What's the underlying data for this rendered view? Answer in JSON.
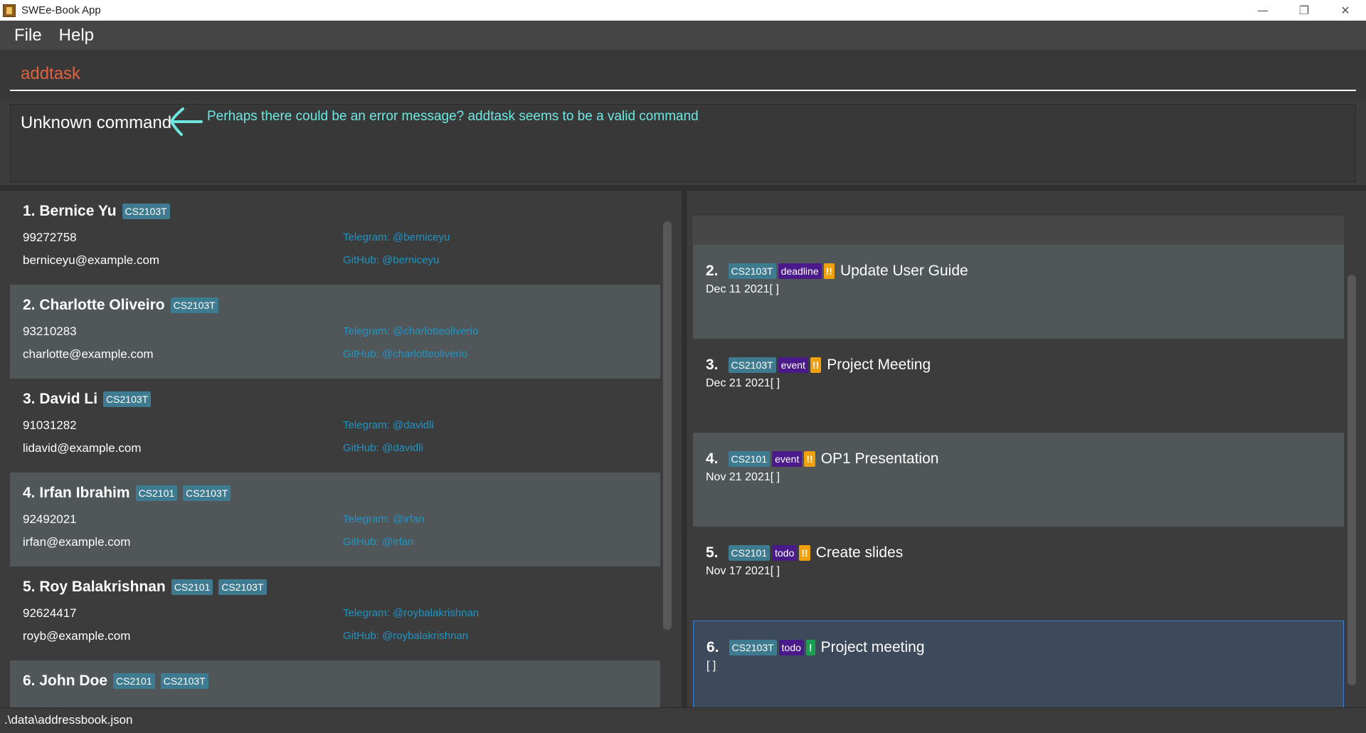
{
  "window": {
    "title": "SWEe-Book App",
    "minimize": "—",
    "restore": "❐",
    "close": "✕"
  },
  "menu": [
    "File",
    "Help"
  ],
  "command": {
    "value": "addtask"
  },
  "result": {
    "text": "Unknown command",
    "annotation": "Perhaps there could be an error message? addtask seems to be a valid command"
  },
  "persons": [
    {
      "index": "1.",
      "name": "Bernice Yu",
      "tags": [
        "CS2103T"
      ],
      "phone": "99272758",
      "email": "berniceyu@example.com",
      "telegram": "Telegram: @berniceyu",
      "github": "GitHub: @berniceyu"
    },
    {
      "index": "2.",
      "name": "Charlotte Oliveiro",
      "tags": [
        "CS2103T"
      ],
      "phone": "93210283",
      "email": "charlotte@example.com",
      "telegram": "Telegram: @charlotteoliverio",
      "github": "GitHub: @charlotteoliverio"
    },
    {
      "index": "3.",
      "name": "David Li",
      "tags": [
        "CS2103T"
      ],
      "phone": "91031282",
      "email": "lidavid@example.com",
      "telegram": "Telegram: @davidli",
      "github": "GitHub: @davidli"
    },
    {
      "index": "4.",
      "name": "Irfan Ibrahim",
      "tags": [
        "CS2101",
        "CS2103T"
      ],
      "phone": "92492021",
      "email": "irfan@example.com",
      "telegram": "Telegram: @irfan",
      "github": "GitHub: @irfan"
    },
    {
      "index": "5.",
      "name": "Roy Balakrishnan",
      "tags": [
        "CS2101",
        "CS2103T"
      ],
      "phone": "92624417",
      "email": "royb@example.com",
      "telegram": "Telegram: @roybalakrishnan",
      "github": "GitHub: @roybalakrishnan"
    },
    {
      "index": "6.",
      "name": "John Doe",
      "tags": [
        "CS2101",
        "CS2103T"
      ],
      "phone": "",
      "email": "",
      "telegram": "",
      "github": ""
    }
  ],
  "tasks": [
    {
      "index": "2.",
      "module": "CS2103T",
      "type": "deadline",
      "priority": "!!",
      "priority_level": "high",
      "name": "Update User Guide",
      "date": "Dec 11 2021[ ]"
    },
    {
      "index": "3.",
      "module": "CS2103T",
      "type": "event",
      "priority": "!!",
      "priority_level": "high",
      "name": "Project Meeting",
      "date": "Dec 21 2021[ ]"
    },
    {
      "index": "4.",
      "module": "CS2101",
      "type": "event",
      "priority": "!!",
      "priority_level": "high",
      "name": "OP1 Presentation",
      "date": "Nov 21 2021[ ]"
    },
    {
      "index": "5.",
      "module": "CS2101",
      "type": "todo",
      "priority": "!!",
      "priority_level": "high",
      "name": "Create slides",
      "date": "Nov 17 2021[ ]"
    },
    {
      "index": "6.",
      "module": "CS2103T",
      "type": "todo",
      "priority": "!",
      "priority_level": "low",
      "name": "Project meeting",
      "date": "[ ]",
      "selected": true
    }
  ],
  "status": {
    "path": ".\\data\\addressbook.json"
  },
  "colors": {
    "background": "#3c3c3c",
    "card_alt": "#515659",
    "tag": "#3e7b91",
    "type_tag": "#4b1a8a",
    "priority_high": "#f0a00a",
    "priority_low": "#1aa050",
    "command_text": "#e0623e",
    "annotation": "#6ee6e0",
    "link": "#1e95c4",
    "selected_border": "#3b7dd8"
  }
}
